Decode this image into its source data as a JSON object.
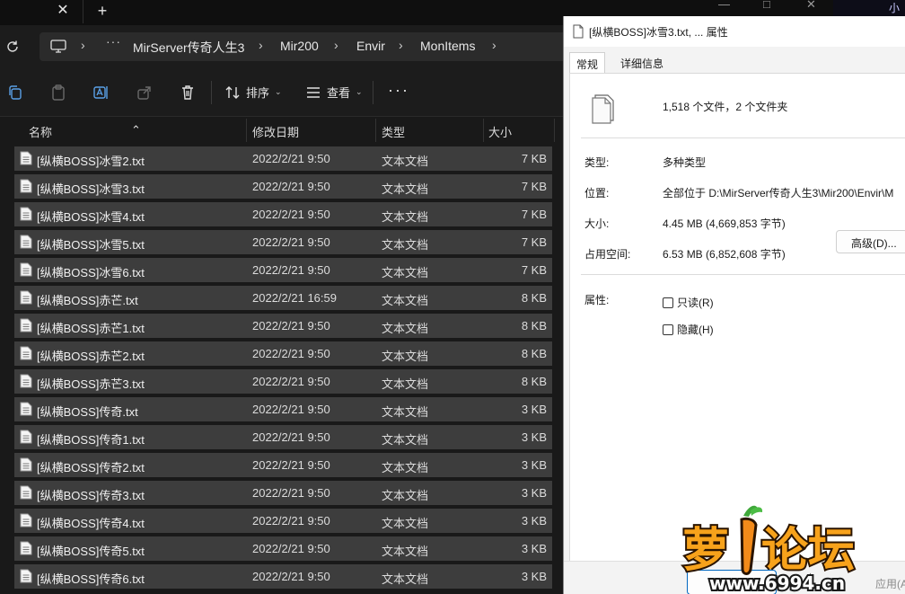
{
  "tabbar": {
    "close_glyph": "✕",
    "new_glyph": "+",
    "corner_text": "小"
  },
  "address": {
    "more": "···",
    "crumbs": [
      "MirServer传奇人生3",
      "Mir200",
      "Envir",
      "MonItems"
    ],
    "chevron": "›"
  },
  "toolbar": {
    "sort_label": "排序",
    "view_label": "查看",
    "more": "···",
    "caret": "⌄"
  },
  "columns": {
    "name": "名称",
    "date": "修改日期",
    "type": "类型",
    "size": "大小"
  },
  "files": [
    {
      "name": "[纵横BOSS]冰雪2.txt",
      "date": "2022/2/21 9:50",
      "type": "文本文档",
      "size": "7 KB"
    },
    {
      "name": "[纵横BOSS]冰雪3.txt",
      "date": "2022/2/21 9:50",
      "type": "文本文档",
      "size": "7 KB"
    },
    {
      "name": "[纵横BOSS]冰雪4.txt",
      "date": "2022/2/21 9:50",
      "type": "文本文档",
      "size": "7 KB"
    },
    {
      "name": "[纵横BOSS]冰雪5.txt",
      "date": "2022/2/21 9:50",
      "type": "文本文档",
      "size": "7 KB"
    },
    {
      "name": "[纵横BOSS]冰雪6.txt",
      "date": "2022/2/21 9:50",
      "type": "文本文档",
      "size": "7 KB"
    },
    {
      "name": "[纵横BOSS]赤芒.txt",
      "date": "2022/2/21 16:59",
      "type": "文本文档",
      "size": "8 KB"
    },
    {
      "name": "[纵横BOSS]赤芒1.txt",
      "date": "2022/2/21 9:50",
      "type": "文本文档",
      "size": "8 KB"
    },
    {
      "name": "[纵横BOSS]赤芒2.txt",
      "date": "2022/2/21 9:50",
      "type": "文本文档",
      "size": "8 KB"
    },
    {
      "name": "[纵横BOSS]赤芒3.txt",
      "date": "2022/2/21 9:50",
      "type": "文本文档",
      "size": "8 KB"
    },
    {
      "name": "[纵横BOSS]传奇.txt",
      "date": "2022/2/21 9:50",
      "type": "文本文档",
      "size": "3 KB"
    },
    {
      "name": "[纵横BOSS]传奇1.txt",
      "date": "2022/2/21 9:50",
      "type": "文本文档",
      "size": "3 KB"
    },
    {
      "name": "[纵横BOSS]传奇2.txt",
      "date": "2022/2/21 9:50",
      "type": "文本文档",
      "size": "3 KB"
    },
    {
      "name": "[纵横BOSS]传奇3.txt",
      "date": "2022/2/21 9:50",
      "type": "文本文档",
      "size": "3 KB"
    },
    {
      "name": "[纵横BOSS]传奇4.txt",
      "date": "2022/2/21 9:50",
      "type": "文本文档",
      "size": "3 KB"
    },
    {
      "name": "[纵横BOSS]传奇5.txt",
      "date": "2022/2/21 9:50",
      "type": "文本文档",
      "size": "3 KB"
    },
    {
      "name": "[纵横BOSS]传奇6.txt",
      "date": "2022/2/21 9:50",
      "type": "文本文档",
      "size": "3 KB"
    }
  ],
  "dialog": {
    "title": "[纵横BOSS]冰雪3.txt, ... 属性",
    "tab_general": "常规",
    "tab_details": "详细信息",
    "count": "1,518 个文件，2 个文件夹",
    "type_label": "类型:",
    "type_value": "多种类型",
    "location_label": "位置:",
    "location_value": "全部位于 D:\\MirServer传奇人生3\\Mir200\\Envir\\M",
    "size_label": "大小:",
    "size_value": "4.45 MB (4,669,853 字节)",
    "disk_label": "占用空间:",
    "disk_value": "6.53 MB (6,852,608 字节)",
    "attr_label": "属性:",
    "readonly_label": "只读(R)",
    "hidden_label": "隐藏(H)",
    "advanced_label": "高级(D)...",
    "ok_label": "确",
    "apply_label": "应用(A"
  },
  "watermark": {
    "title": "萝卜论坛",
    "url": "www.6994.cn"
  },
  "colors": {
    "accent": "#0067c0",
    "row_bg": "#3d3d3d",
    "carrot": "#f28a1a"
  }
}
